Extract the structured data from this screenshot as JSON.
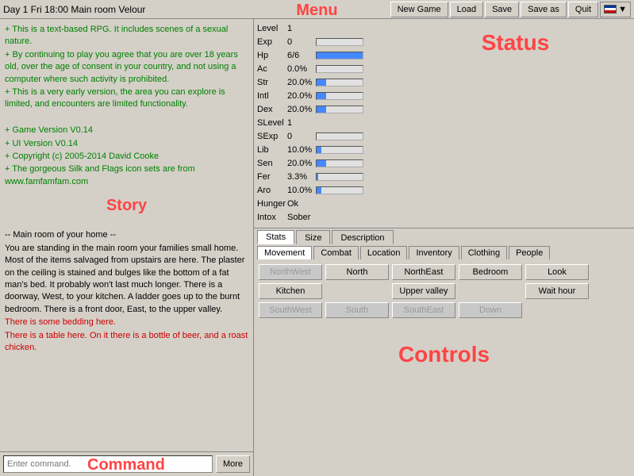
{
  "title": "Day 1  Fri 18:00  Main room  Velour",
  "menu_label": "Menu",
  "top_buttons": {
    "new_game": "New Game",
    "load": "Load",
    "save": "Save",
    "save_as": "Save as",
    "quit": "Quit"
  },
  "story_label": "Story",
  "story_lines": [
    {
      "text": "+ This is a text-based RPG. It includes scenes of a sexual nature.",
      "color": "green"
    },
    {
      "text": "+ By continuing to play you agree that you are over 18 years old, over the age of consent in your country, and not using a computer where such activity is prohibited.",
      "color": "green"
    },
    {
      "text": "+ This is a very early version, the area you can explore is limited, and encounters are limited functionality.",
      "color": "green"
    },
    {
      "text": ""
    },
    {
      "text": "+ Game Version V0.14",
      "color": "green"
    },
    {
      "text": "+ UI Version V0.14",
      "color": "green"
    },
    {
      "text": "+ Copyright (c) 2005-2014 David Cooke",
      "color": "green"
    },
    {
      "text": "+ The gorgeous Silk and Flags icon sets are from www.famfamfam.com",
      "color": "green"
    },
    {
      "text": ""
    },
    {
      "text": "-- Main room of your home --",
      "color": "normal"
    },
    {
      "text": "You are standing in the main room your families small home. Most of the items salvaged from upstairs are here. The plaster on the ceiling is stained and bulges like the bottom of a fat man's bed. It probably won't last much longer. There is a doorway, West, to your kitchen. A ladder goes up to the burnt bedroom. There is a front door, East, to the upper valley.",
      "color": "normal"
    },
    {
      "text": "There is some bedding here.",
      "color": "red"
    },
    {
      "text": "There is a table here. On it there is a bottle of beer, and a roast chicken.",
      "color": "red"
    }
  ],
  "command_placeholder": "Enter command.",
  "command_label": "Command",
  "more_btn": "More",
  "status_label": "Status",
  "stats": [
    {
      "label": "Level",
      "value": "1",
      "bar": 0
    },
    {
      "label": "Exp",
      "value": "0",
      "bar": 0
    },
    {
      "label": "Hp",
      "value": "6/6",
      "bar": 100
    },
    {
      "label": "Ac",
      "value": "0.0%",
      "bar": 0
    },
    {
      "label": "Str",
      "value": "20.0%",
      "bar": 20
    },
    {
      "label": "Intl",
      "value": "20.0%",
      "bar": 20
    },
    {
      "label": "Dex",
      "value": "20.0%",
      "bar": 20
    },
    {
      "label": "SLevel",
      "value": "1",
      "bar": 0
    },
    {
      "label": "SExp",
      "value": "0",
      "bar": 0
    },
    {
      "label": "Lib",
      "value": "10.0%",
      "bar": 10
    },
    {
      "label": "Sen",
      "value": "20.0%",
      "bar": 20
    },
    {
      "label": "Fer",
      "value": "3.3%",
      "bar": 3
    },
    {
      "label": "Aro",
      "value": "10.0%",
      "bar": 10
    },
    {
      "label": "Hunger",
      "value": "Ok",
      "bar": 0
    },
    {
      "label": "Intox",
      "value": "Sober",
      "bar": 0
    }
  ],
  "char_tabs": [
    "Stats",
    "Size",
    "Description"
  ],
  "active_char_tab": "Stats",
  "ctrl_tabs": [
    "Movement",
    "Combat",
    "Location",
    "Inventory",
    "Clothing",
    "People"
  ],
  "active_ctrl_tab": "Movement",
  "controls_label": "Controls",
  "movement": {
    "row1": [
      {
        "label": "NorthWest",
        "enabled": false
      },
      {
        "label": "North",
        "enabled": true
      },
      {
        "label": "NorthEast",
        "enabled": true
      },
      {
        "label": "Bedroom",
        "enabled": true
      },
      {
        "label": "Look",
        "enabled": true
      }
    ],
    "row2": [
      {
        "label": "Kitchen",
        "enabled": true
      },
      {
        "label": "",
        "enabled": false
      },
      {
        "label": "Upper valley",
        "enabled": true
      },
      {
        "label": "",
        "enabled": false
      },
      {
        "label": "Wait hour",
        "enabled": true
      }
    ],
    "row3": [
      {
        "label": "SouthWest",
        "enabled": false
      },
      {
        "label": "South",
        "enabled": false
      },
      {
        "label": "SouthEast",
        "enabled": false
      },
      {
        "label": "Down",
        "enabled": false
      }
    ]
  }
}
